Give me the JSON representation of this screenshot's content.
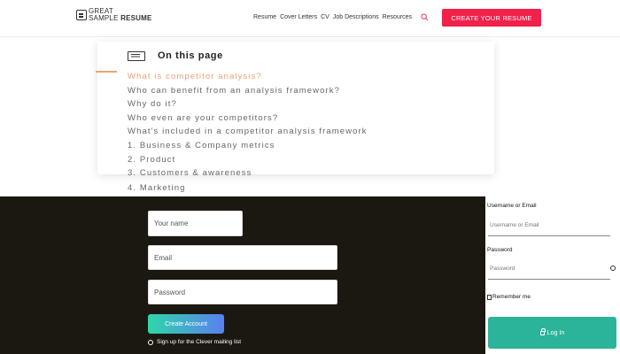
{
  "header": {
    "logo": {
      "line1": "GREAT",
      "line2": "SAMPLE",
      "line3": "RESUME"
    },
    "nav": [
      "Resume",
      "Cover Letters",
      "CV",
      "Job Descriptions",
      "Resources"
    ],
    "search_icon": "search-icon",
    "cta_label": "CREATE YOUR RESUME"
  },
  "toc": {
    "title": "On this page",
    "items": [
      "What is competitor analysis?",
      "Who can benefit from an analysis framework?",
      "Why do it?",
      "Who even are your competitors?",
      "What's included in a competitor analysis framework",
      "1. Business & Company metrics",
      "2. Product",
      "3. Customers & awareness"
    ],
    "overflow_item": "4. Marketing",
    "active_index": 0
  },
  "signup": {
    "name_placeholder": "Your name",
    "email_placeholder": "Email",
    "password_placeholder": "Password",
    "create_label": "Create Account",
    "optin_label": "Sign up for the Clever mailing list"
  },
  "login": {
    "username_label": "Username or Email",
    "username_placeholder": "Username or Email",
    "password_label": "Password",
    "password_placeholder": "Password",
    "remember_label": "Remember me",
    "login_label": "Log In"
  },
  "colors": {
    "brand": "#f0214a",
    "toc_active": "#f0a070",
    "signup_bg": "#1b1812",
    "login_btn": "#2bb49a"
  }
}
